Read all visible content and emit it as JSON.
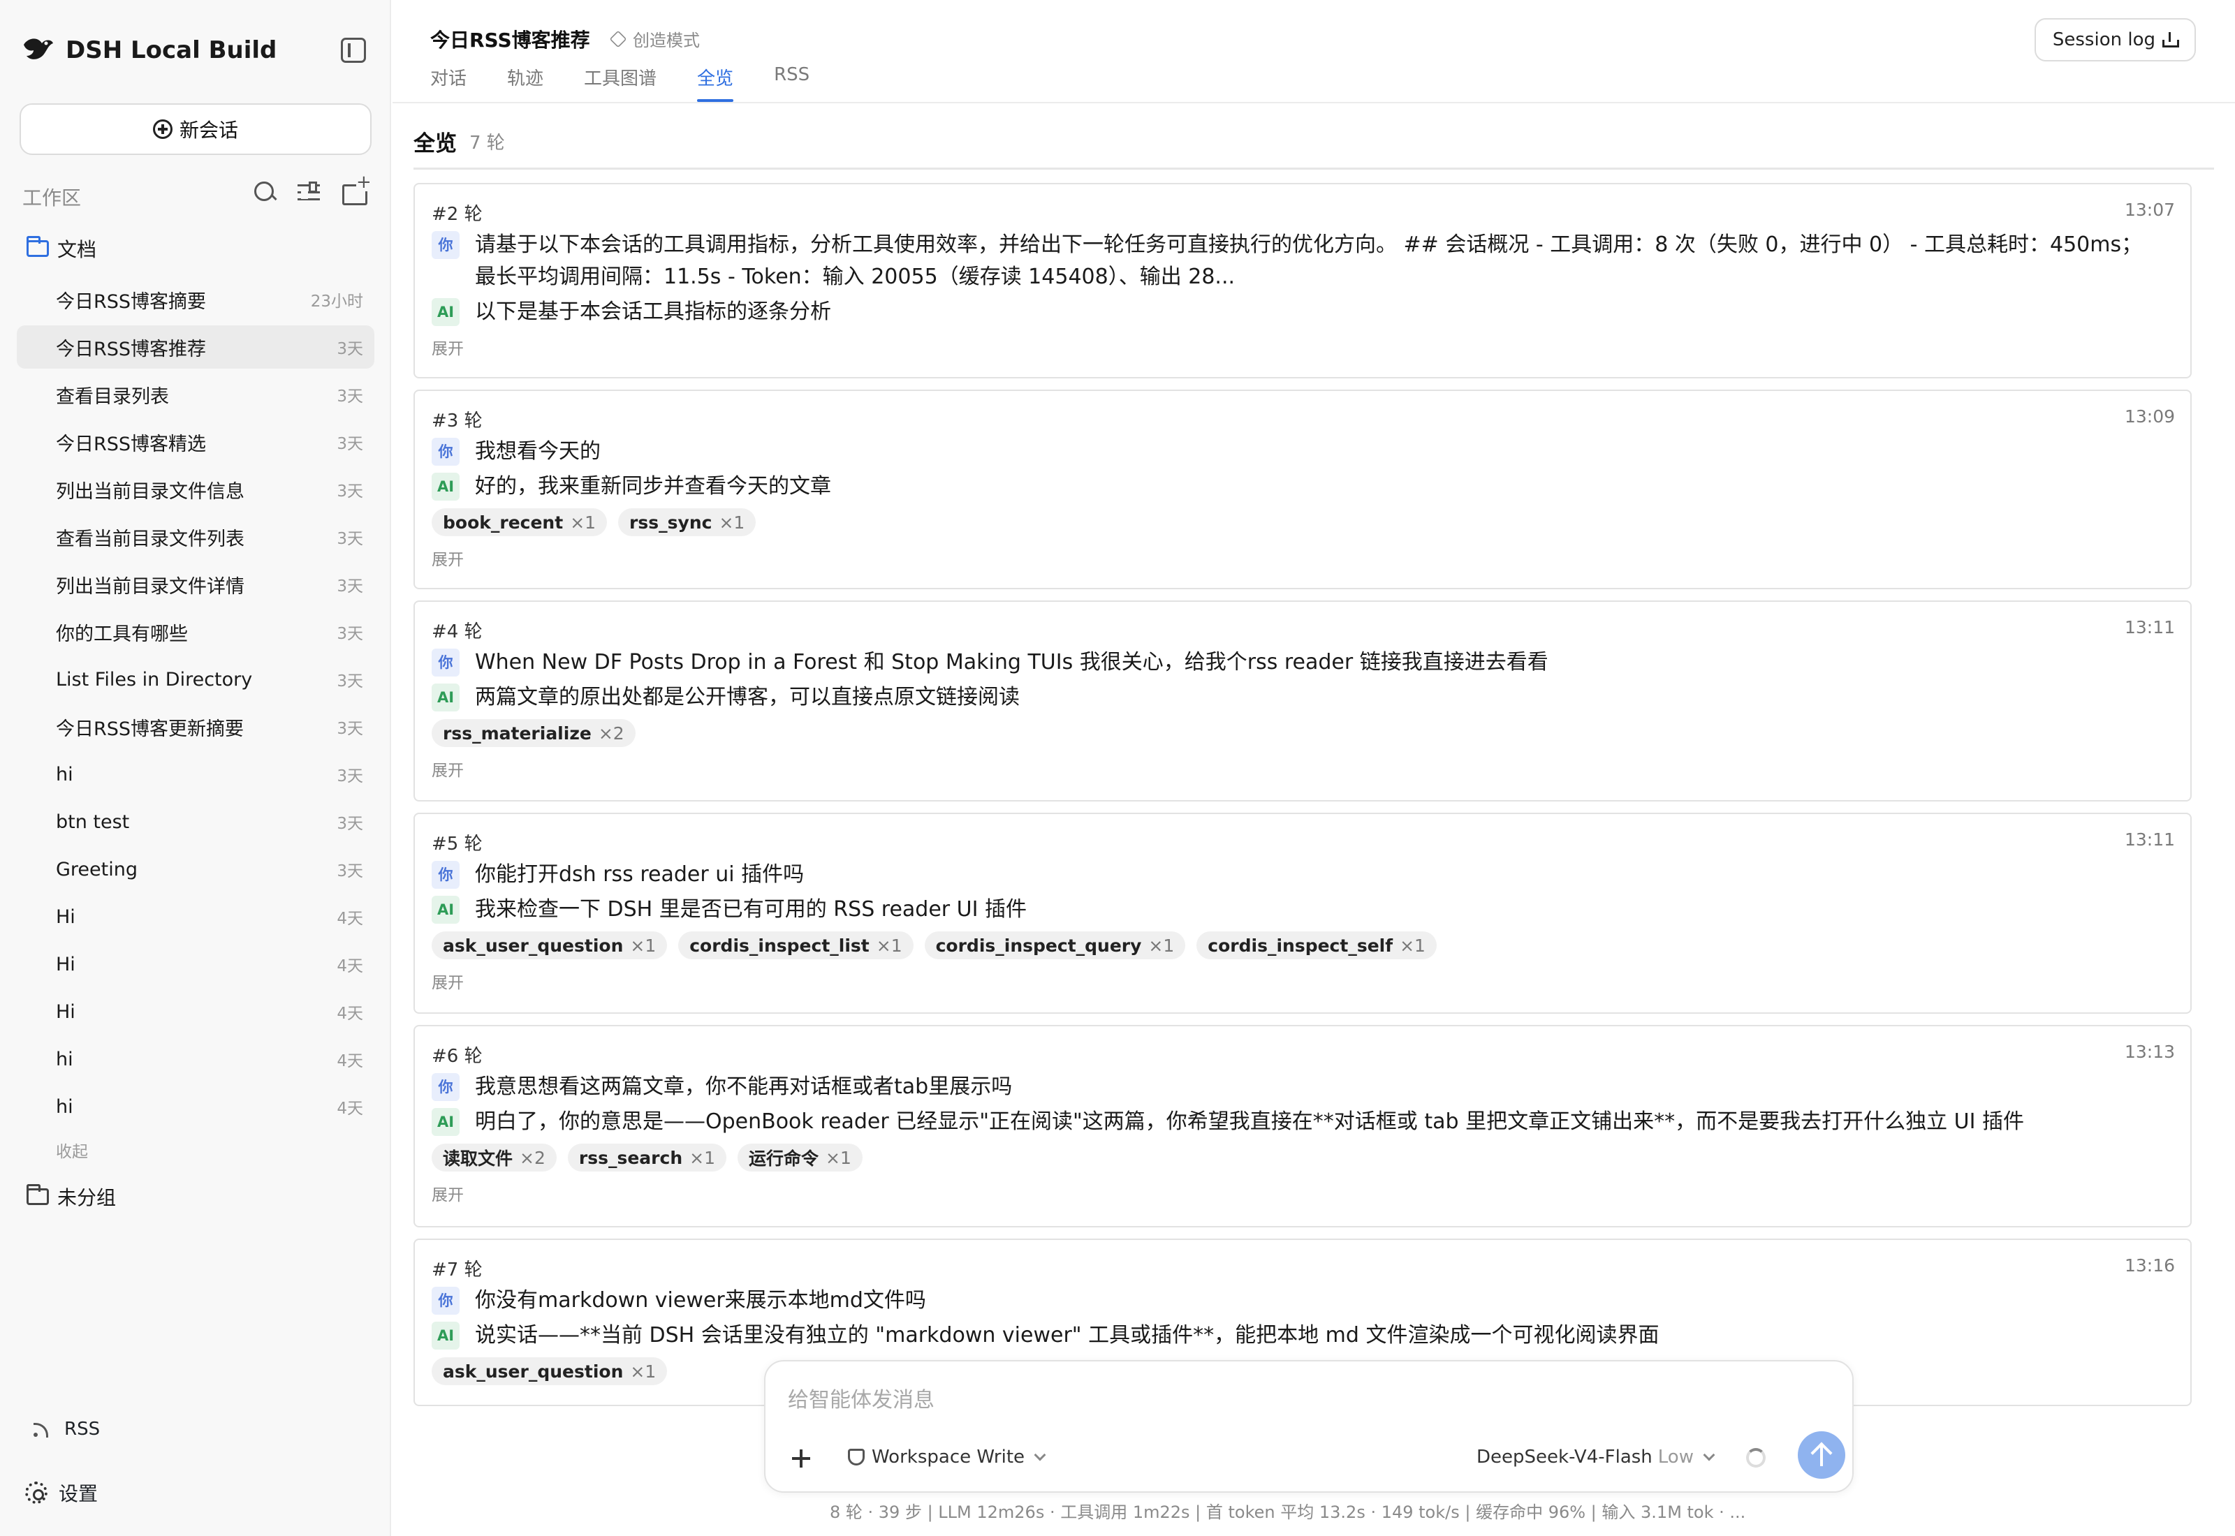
{
  "app": {
    "name": "DSH Local Build"
  },
  "sidebar": {
    "new_chat_label": "新会话",
    "workspace_label": "工作区",
    "folder_docs": "文档",
    "items": [
      {
        "title": "今日RSS博客摘要",
        "age": "23小时"
      },
      {
        "title": "今日RSS博客推荐",
        "age": "3天"
      },
      {
        "title": "查看目录列表",
        "age": "3天"
      },
      {
        "title": "今日RSS博客精选",
        "age": "3天"
      },
      {
        "title": "列出当前目录文件信息",
        "age": "3天"
      },
      {
        "title": "查看当前目录文件列表",
        "age": "3天"
      },
      {
        "title": "列出当前目录文件详情",
        "age": "3天"
      },
      {
        "title": "你的工具有哪些",
        "age": "3天"
      },
      {
        "title": "List Files in Directory",
        "age": "3天"
      },
      {
        "title": "今日RSS博客更新摘要",
        "age": "3天"
      },
      {
        "title": "hi",
        "age": "3天"
      },
      {
        "title": "btn test",
        "age": "3天"
      },
      {
        "title": "Greeting",
        "age": "3天"
      },
      {
        "title": "Hi",
        "age": "4天"
      },
      {
        "title": "Hi",
        "age": "4天"
      },
      {
        "title": "Hi",
        "age": "4天"
      },
      {
        "title": "hi",
        "age": "4天"
      },
      {
        "title": "hi",
        "age": "4天"
      }
    ],
    "active_index": 1,
    "collapse_label": "收起",
    "folder_ungrouped": "未分组",
    "rss_label": "RSS",
    "settings_label": "设置"
  },
  "header": {
    "title": "今日RSS博客推荐",
    "mode": "创造模式",
    "tabs": [
      "对话",
      "轨迹",
      "工具图谱",
      "全览",
      "RSS"
    ],
    "active_tab": 3,
    "session_log": "Session log"
  },
  "overview": {
    "title": "全览",
    "count": "7 轮",
    "expand_label": "展开",
    "you_badge": "你",
    "ai_badge": "AI",
    "cards": [
      {
        "num": "#2 轮",
        "time": "13:07",
        "user": "请基于以下本会话的工具调用指标，分析工具使用效率，并给出下一轮任务可直接执行的优化方向。 ## 会话概况 - 工具调用：8 次（失败 0，进行中 0） - 工具总耗时：450ms；最长平均调用间隔：11.5s - Token：输入 20055（缓存读 145408）、输出 28...",
        "ai": "以下是基于本会话工具指标的逐条分析",
        "tools": []
      },
      {
        "num": "#3 轮",
        "time": "13:09",
        "user": "我想看今天的",
        "ai": "好的，我来重新同步并查看今天的文章",
        "tools": [
          {
            "name": "book_recent",
            "count": "×1"
          },
          {
            "name": "rss_sync",
            "count": "×1"
          }
        ]
      },
      {
        "num": "#4 轮",
        "time": "13:11",
        "user": "When New DF Posts Drop in a Forest 和 Stop Making TUIs 我很关心，给我个rss reader 链接我直接进去看看",
        "ai": "两篇文章的原出处都是公开博客，可以直接点原文链接阅读",
        "tools": [
          {
            "name": "rss_materialize",
            "count": "×2"
          }
        ]
      },
      {
        "num": "#5 轮",
        "time": "13:11",
        "user": "你能打开dsh rss reader ui 插件吗",
        "ai": "我来检查一下 DSH 里是否已有可用的 RSS reader UI 插件",
        "tools": [
          {
            "name": "ask_user_question",
            "count": "×1"
          },
          {
            "name": "cordis_inspect_list",
            "count": "×1"
          },
          {
            "name": "cordis_inspect_query",
            "count": "×1"
          },
          {
            "name": "cordis_inspect_self",
            "count": "×1"
          }
        ]
      },
      {
        "num": "#6 轮",
        "time": "13:13",
        "user": "我意思想看这两篇文章，你不能再对话框或者tab里展示吗",
        "ai": "明白了，你的意思是——OpenBook reader 已经显示\"正在阅读\"这两篇，你希望我直接在**对话框或 tab 里把文章正文铺出来**，而不是要我去打开什么独立 UI 插件",
        "tools": [
          {
            "name": "读取文件",
            "count": "×2"
          },
          {
            "name": "rss_search",
            "count": "×1"
          },
          {
            "name": "运行命令",
            "count": "×1"
          }
        ]
      },
      {
        "num": "#7 轮",
        "time": "13:16",
        "user": "你没有markdown viewer来展示本地md文件吗",
        "ai": "说实话——**当前 DSH 会话里没有独立的 \"markdown viewer\" 工具或插件**，能把本地 md 文件渲染成一个可视化阅读界面",
        "tools": [
          {
            "name": "ask_user_question",
            "count": "×1"
          }
        ]
      }
    ]
  },
  "composer": {
    "placeholder": "给智能体发消息",
    "workspace": "Workspace Write",
    "model": "DeepSeek-V4-Flash",
    "level": "Low"
  },
  "stats": "8 轮 · 39 步   |   LLM 12m26s · 工具调用 1m22s   |   首 token 平均 13.2s · 149 tok/s   |   缓存命中 96%   |   输入 3.1M tok · ..."
}
